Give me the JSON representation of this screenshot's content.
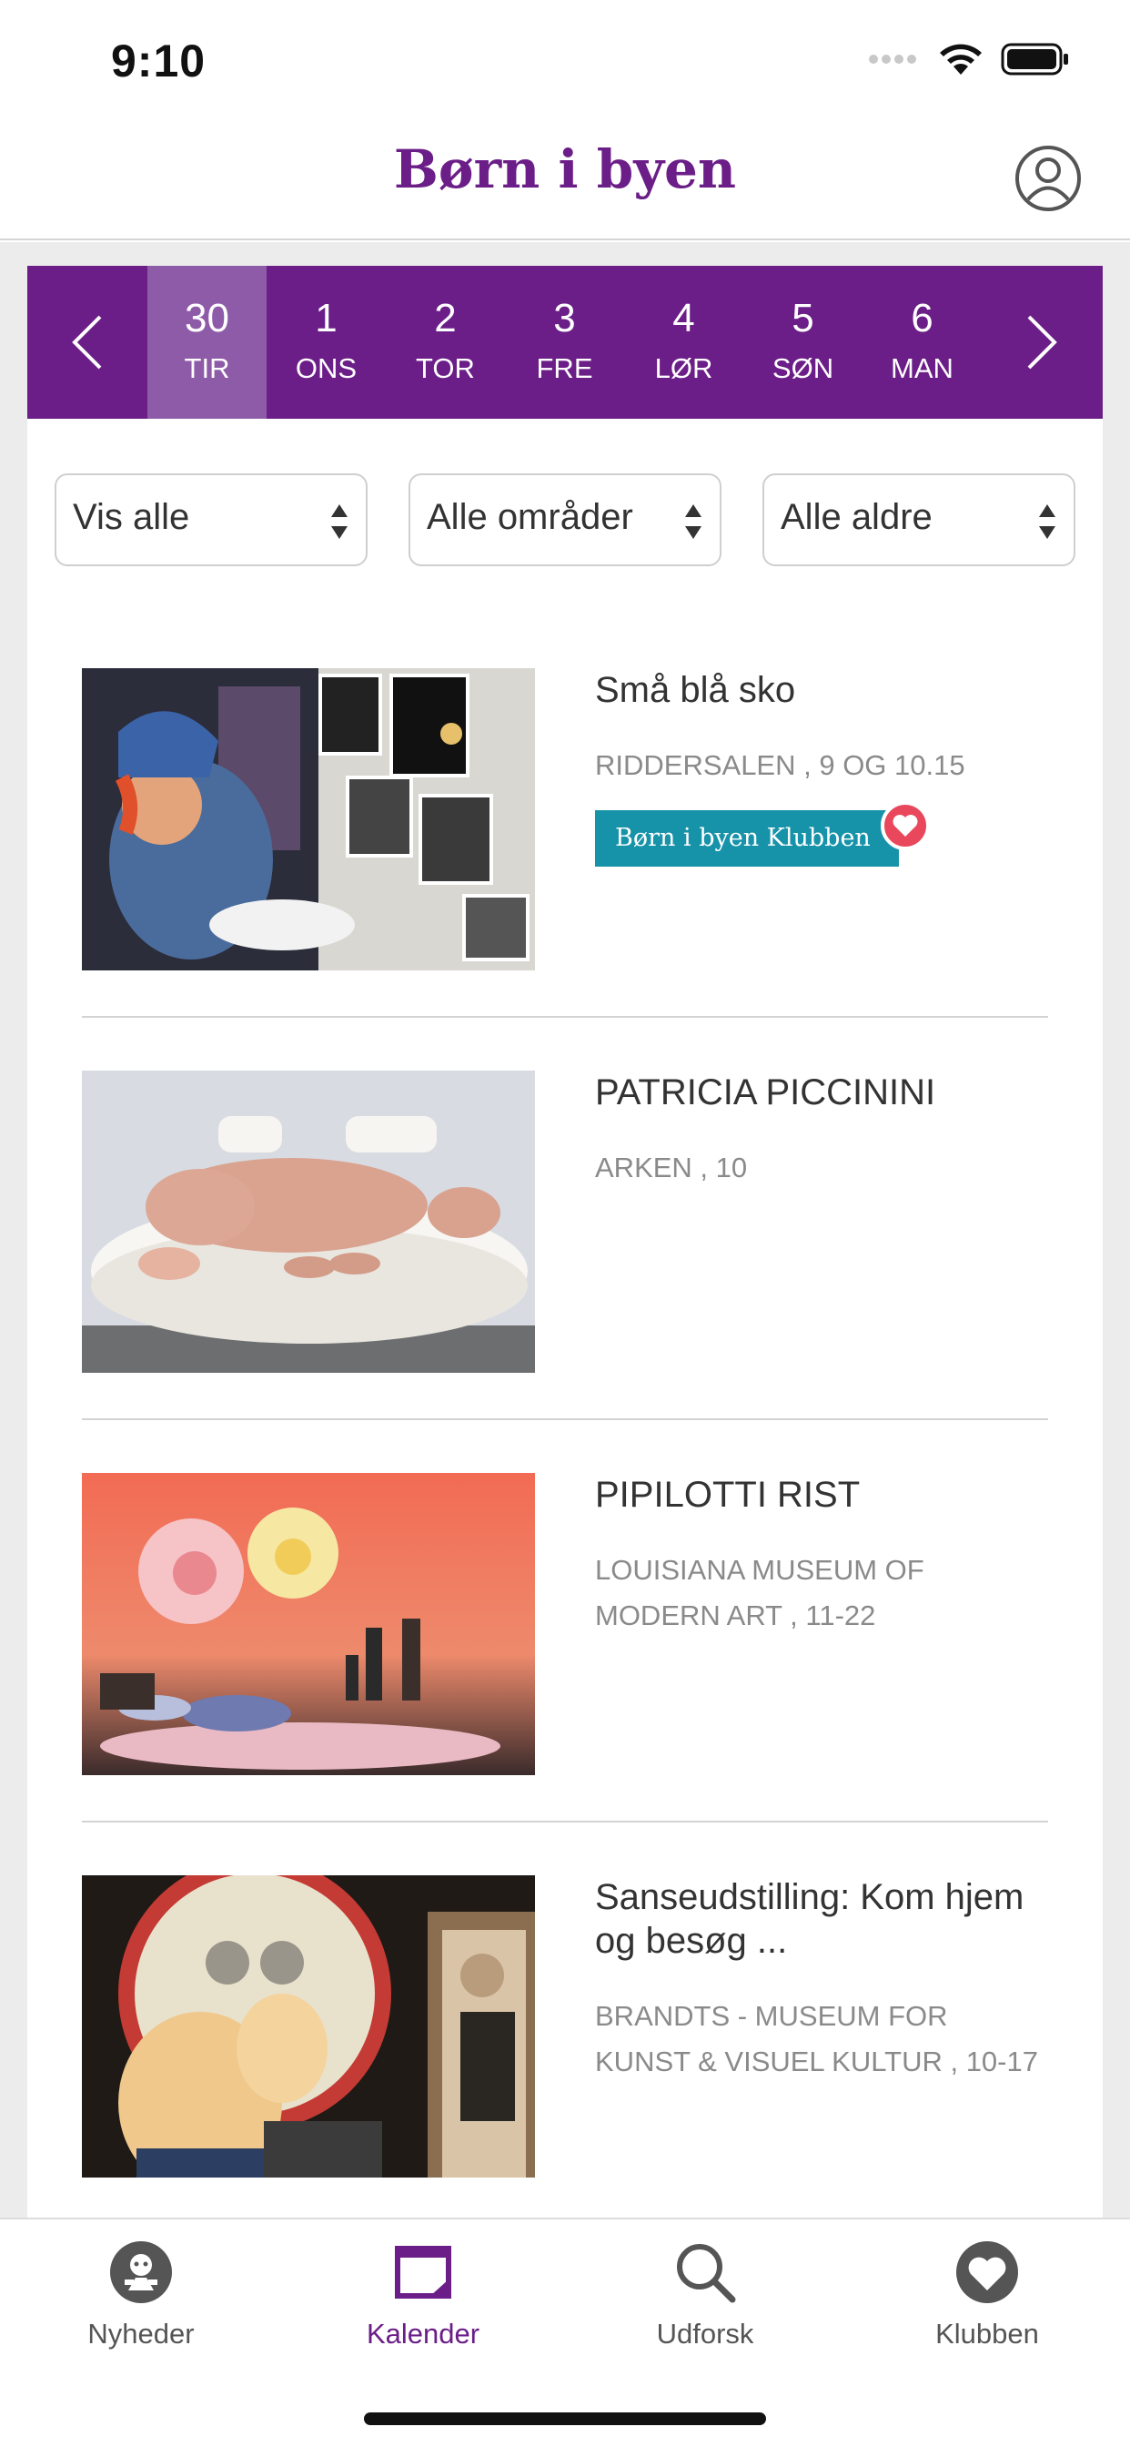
{
  "status_bar": {
    "time": "9:10"
  },
  "header": {
    "logo": "Børn i byen"
  },
  "date_strip": {
    "days": [
      {
        "num": "30",
        "name": "TIR",
        "selected": true
      },
      {
        "num": "1",
        "name": "ONS"
      },
      {
        "num": "2",
        "name": "TOR"
      },
      {
        "num": "3",
        "name": "FRE"
      },
      {
        "num": "4",
        "name": "LØR"
      },
      {
        "num": "5",
        "name": "SØN"
      },
      {
        "num": "6",
        "name": "MAN"
      }
    ]
  },
  "filters": [
    {
      "label": "Vis alle"
    },
    {
      "label": "Alle områder"
    },
    {
      "label": "Alle aldre"
    }
  ],
  "events": [
    {
      "title": "Små blå sko",
      "place": "RIDDERSALEN , 9 OG 10.15",
      "badge": "Børn i byen Klubben"
    },
    {
      "title": "PATRICIA PICCININI",
      "place": "ARKEN , 10"
    },
    {
      "title": "PIPILOTTI RIST",
      "place": "LOUISIANA MUSEUM OF MODERN ART , 11-22"
    },
    {
      "title": "Sanseudstilling: Kom hjem og besøg ...",
      "place": "BRANDTS - MUSEUM FOR KUNST & VISUEL KULTUR , 10-17"
    }
  ],
  "tabs": [
    {
      "label": "Nyheder",
      "icon": "nyheder-icon"
    },
    {
      "label": "Kalender",
      "icon": "calendar-icon",
      "active": true
    },
    {
      "label": "Udforsk",
      "icon": "search-icon"
    },
    {
      "label": "Klubben",
      "icon": "heart-icon"
    }
  ],
  "colors": {
    "brand_purple": "#6b1e87",
    "selected_day": "#8e5ba9",
    "badge_teal": "#1793a9",
    "heart_red": "#e9475b"
  }
}
